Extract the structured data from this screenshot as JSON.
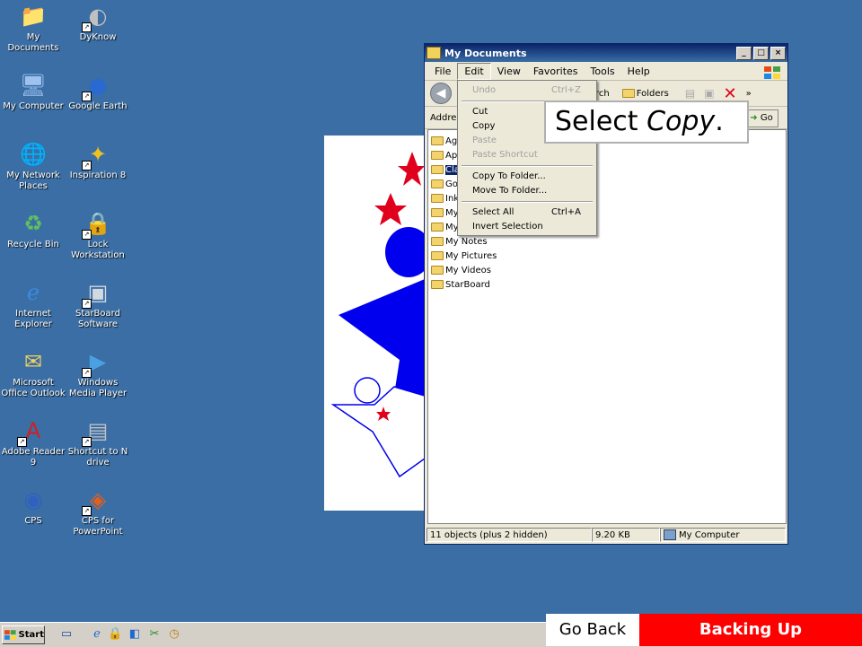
{
  "desktop_icons": [
    {
      "label": "My Documents",
      "icon": "my-documents-icon"
    },
    {
      "label": "DyKnow",
      "icon": "dyknow-icon"
    },
    {
      "label": "My Computer",
      "icon": "my-computer-icon"
    },
    {
      "label": "Google Earth",
      "icon": "google-earth-icon"
    },
    {
      "label": "My Network Places",
      "icon": "network-places-icon"
    },
    {
      "label": "Inspiration 8",
      "icon": "inspiration-icon"
    },
    {
      "label": "Recycle Bin",
      "icon": "recycle-bin-icon"
    },
    {
      "label": "Lock Workstation",
      "icon": "lock-icon"
    },
    {
      "label": "Internet Explorer",
      "icon": "internet-explorer-icon"
    },
    {
      "label": "StarBoard Software",
      "icon": "starboard-icon"
    },
    {
      "label": "Microsoft Office Outlook",
      "icon": "outlook-icon"
    },
    {
      "label": "Windows Media Player",
      "icon": "media-player-icon"
    },
    {
      "label": "Adobe Reader 9",
      "icon": "adobe-reader-icon"
    },
    {
      "label": "Shortcut to N drive",
      "icon": "network-drive-icon"
    },
    {
      "label": "CPS",
      "icon": "cps-icon"
    },
    {
      "label": "CPS for PowerPoint",
      "icon": "cps-powerpoint-icon"
    }
  ],
  "window": {
    "title": "My Documents",
    "menu": [
      "File",
      "Edit",
      "View",
      "Favorites",
      "Tools",
      "Help"
    ],
    "toolbar": {
      "search_fragment": "rch",
      "folders": "Folders"
    },
    "address_label": "Addre",
    "go_label": "Go",
    "files": [
      {
        "name": "Agi",
        "selected": false
      },
      {
        "name": "App",
        "selected": false
      },
      {
        "name": "Cla",
        "selected": true
      },
      {
        "name": "Gol",
        "selected": false
      },
      {
        "name": "Ink",
        "selected": false
      },
      {
        "name": "My",
        "selected": false
      },
      {
        "name": "My",
        "selected": false
      },
      {
        "name": "My Notes",
        "selected": false
      },
      {
        "name": "My Pictures",
        "selected": false
      },
      {
        "name": "My Videos",
        "selected": false
      },
      {
        "name": "StarBoard",
        "selected": false
      }
    ],
    "status": {
      "objects": "11 objects (plus 2 hidden)",
      "size": "9.20 KB",
      "location": "My Computer"
    }
  },
  "edit_menu": {
    "undo": "Undo",
    "undo_sc": "Ctrl+Z",
    "cut": "Cut",
    "copy": "Copy",
    "paste": "Paste",
    "paste_shortcut": "Paste Shortcut",
    "copy_to": "Copy To Folder...",
    "move_to": "Move To Folder...",
    "select_all": "Select All",
    "select_all_sc": "Ctrl+A",
    "invert": "Invert Selection"
  },
  "callout": {
    "prefix": "Select ",
    "emphasis": "Copy",
    "suffix": "."
  },
  "taskbar": {
    "start": "Start"
  },
  "nav": {
    "back": "Go Back",
    "title": "Backing Up"
  },
  "colors": {
    "desktop": "#3a6ea5",
    "accent_red": "#ff0000",
    "selection": "#0a246a",
    "star_blue": "#0000ee",
    "star_red": "#e0001b"
  }
}
